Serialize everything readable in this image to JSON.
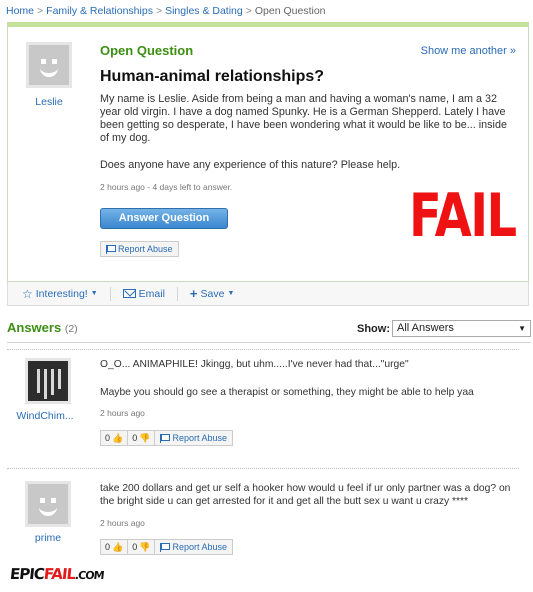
{
  "breadcrumb": {
    "home": "Home",
    "category": "Family & Relationships",
    "subcategory": "Singles & Dating",
    "current": "Open Question",
    "separator": ">"
  },
  "question": {
    "status": "Open Question",
    "show_another": "Show me another »",
    "title": "Human-animal relationships?",
    "asker": "Leslie",
    "body_paragraph_1": "My name is Leslie. Aside from being a man and having a woman's name, I am a 32 year old virgin. I have a dog named Spunky. He is a German Shepperd. Lately I have been getting so desperate, I have been wondering what it would be like to be... inside of my dog.",
    "body_paragraph_2": "Does anyone have any experience of this nature? Please help.",
    "meta": "2 hours ago - 4 days left to answer.",
    "answer_button": "Answer Question",
    "report_abuse": "Report Abuse"
  },
  "overlay": {
    "fail_stamp": "FAIL",
    "watermark_epic": "EPIC",
    "watermark_fail": "FAIL",
    "watermark_com": ".COM",
    "fail_color": "#ee1212"
  },
  "actions": {
    "interesting": "Interesting!",
    "email": "Email",
    "save": "Save"
  },
  "answers": {
    "heading": "Answers",
    "count": "(2)",
    "show_label": "Show:",
    "show_value": "All Answers",
    "items": [
      {
        "author": "WindChim...",
        "avatar": "wind-chime-photo",
        "line_1": "O_O... ANIMAPHILE! Jkingg, but uhm.....I've never had that...\"urge\"",
        "line_2": "Maybe you should go see a therapist or something, they might be able to help yaa",
        "time": "2 hours ago",
        "thumbs_up": "0",
        "thumbs_down": "0",
        "report": "Report Abuse"
      },
      {
        "author": "prime",
        "avatar": "default-smiley-avatar",
        "text": "take 200 dollars and get ur self a hooker how would u feel if ur only partner was a dog? on the bright side u can get arrested for it and get all the butt sex u want u crazy ****",
        "time": "2 hours ago",
        "thumbs_up": "0",
        "thumbs_down": "0",
        "report": "Report Abuse"
      }
    ]
  },
  "colors": {
    "link": "#2a6cb6",
    "green_heading": "#3d8f14",
    "question_border_top": "#c4e19a",
    "button_blue": "#3a86cf"
  }
}
